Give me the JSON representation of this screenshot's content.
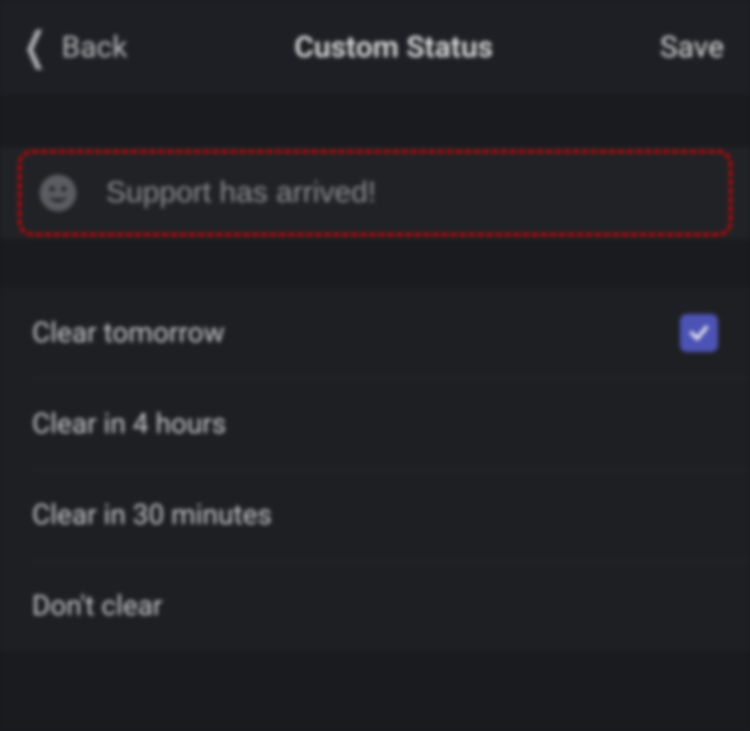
{
  "header": {
    "back_label": "Back",
    "title": "Custom Status",
    "save_label": "Save"
  },
  "status": {
    "placeholder": "Support has arrived!",
    "value": ""
  },
  "clear_options": [
    {
      "label": "Clear tomorrow",
      "selected": true
    },
    {
      "label": "Clear in 4 hours",
      "selected": false
    },
    {
      "label": "Clear in 30 minutes",
      "selected": false
    },
    {
      "label": "Don't clear",
      "selected": false
    }
  ]
}
